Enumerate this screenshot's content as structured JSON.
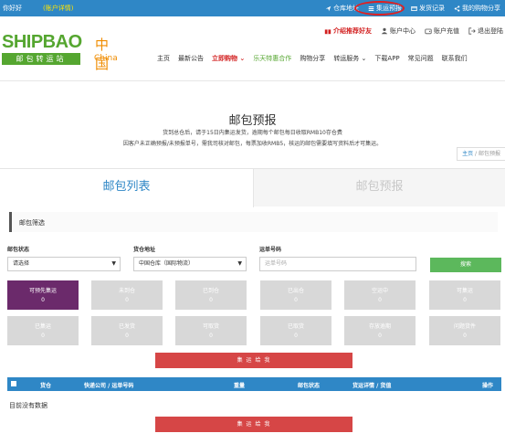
{
  "topbar": {
    "greeting": "你好好",
    "account_link": "(账户详情)",
    "links": [
      {
        "label": "仓库地址",
        "icon": "send-icon"
      },
      {
        "label": "集运预报",
        "icon": "list-icon"
      },
      {
        "label": "发货记录",
        "icon": "card-icon"
      },
      {
        "label": "我的购物分享",
        "icon": "share-icon"
      }
    ]
  },
  "logo": {
    "ship": "SHIPBAO",
    "zh": "邮包转运站",
    "cn1": "中国",
    "cn2": "China"
  },
  "subnav": [
    {
      "label": "介绍推荐好友",
      "icon": "gift-icon"
    },
    {
      "label": "账户中心",
      "icon": "user-icon"
    },
    {
      "label": "账户充值",
      "icon": "wallet-icon"
    },
    {
      "label": "退出登陆",
      "icon": "logout-icon"
    }
  ],
  "mainnav": [
    {
      "label": "主页"
    },
    {
      "label": "最新公告"
    },
    {
      "label": "立即购物 ⌄"
    },
    {
      "label": "乐天特惠合作"
    },
    {
      "label": "购物分享"
    },
    {
      "label": "转运服务 ⌄"
    },
    {
      "label": "下载APP"
    },
    {
      "label": "常见问题"
    },
    {
      "label": "联系我们"
    }
  ],
  "page": {
    "title": "邮包预报",
    "desc1": "货到总仓后，请于15日内集运发货，逾期每个邮包每日收取RMB10存仓费",
    "desc2": "因客户未正确预报/未预报单号，需我司核对邮包，每票加收RMB5，核运的邮包需要填写资料后才可集运。",
    "breadcrumb_home": "主页",
    "breadcrumb_sep": " / ",
    "breadcrumb_current": "邮包预报"
  },
  "tabs": {
    "active": "邮包列表",
    "inactive": "邮包预报"
  },
  "filter": {
    "title": "邮包筛选",
    "status_label": "邮包状态",
    "status_value": "请选择",
    "address_label": "货仓地址",
    "address_value": "中国仓库（国际物流）",
    "tracking_label": "运单号码",
    "tracking_placeholder": "运单号码",
    "search_label": "搜索"
  },
  "status_buttons": [
    {
      "label": "可预先集运",
      "count": "0"
    },
    {
      "label": "未到仓",
      "count": "0"
    },
    {
      "label": "已到仓",
      "count": "0"
    },
    {
      "label": "已出仓",
      "count": "0"
    },
    {
      "label": "空运中",
      "count": "0"
    },
    {
      "label": "可集运",
      "count": "0"
    },
    {
      "label": "已集运",
      "count": "0"
    },
    {
      "label": "已发货",
      "count": "0"
    },
    {
      "label": "可取货",
      "count": "0"
    },
    {
      "label": "已取货",
      "count": "0"
    },
    {
      "label": "存放逾期",
      "count": "0"
    },
    {
      "label": "问题货件",
      "count": "0"
    }
  ],
  "action": {
    "ship_label": "集 运 给 我"
  },
  "table": {
    "headers": [
      "货仓",
      "快递公司 / 运单号码",
      "重量",
      "邮包状态",
      "货运详情 / 货值",
      "操作"
    ],
    "empty_text": "目前没有数据"
  }
}
